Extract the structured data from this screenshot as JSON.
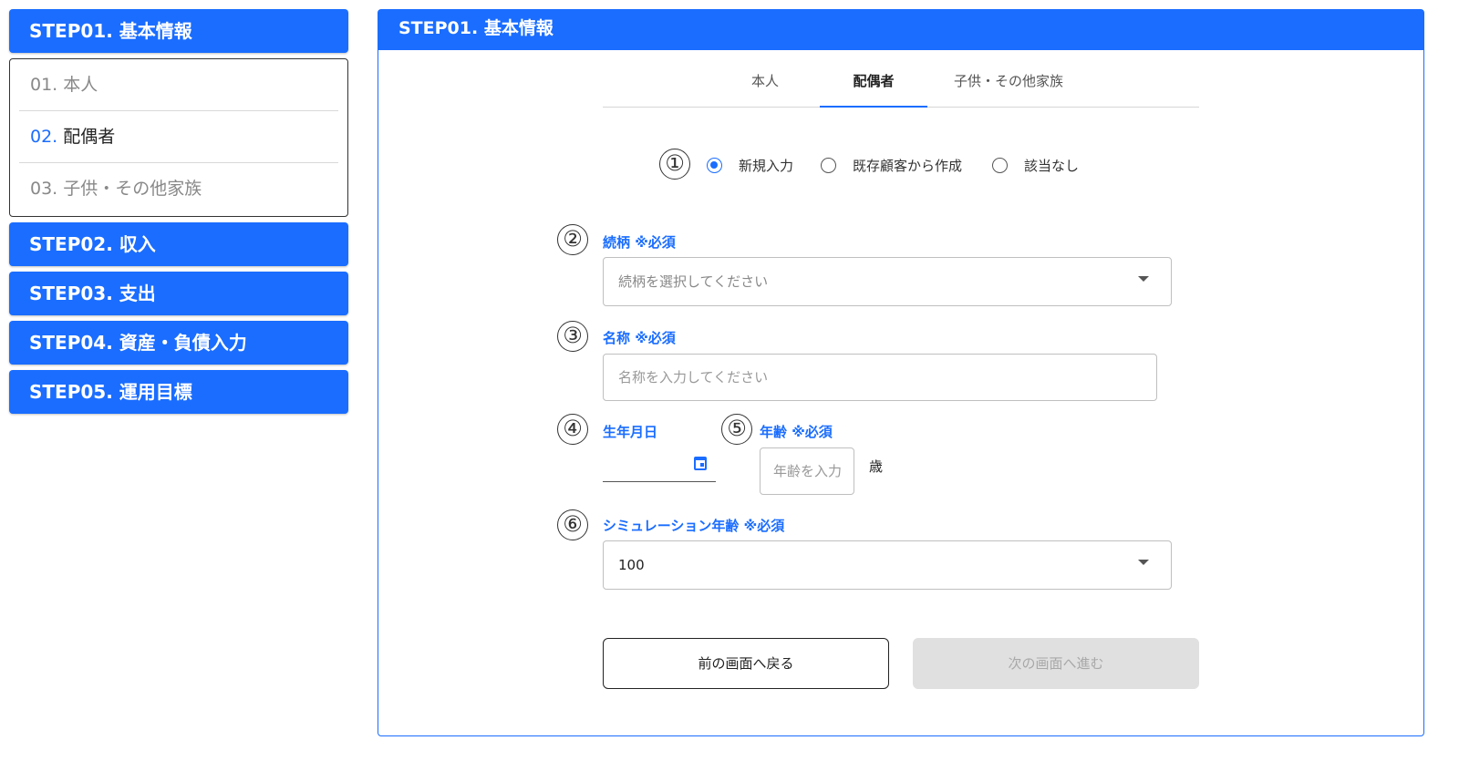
{
  "sidebar": {
    "step1": "STEP01. 基本情報",
    "substeps": [
      {
        "num": "01.",
        "label": "本人"
      },
      {
        "num": "02.",
        "label": "配偶者"
      },
      {
        "num": "03.",
        "label": "子供・その他家族"
      }
    ],
    "step2": "STEP02. 収入",
    "step3": "STEP03. 支出",
    "step4": "STEP04. 資産・負債入力",
    "step5": "STEP05. 運用目標"
  },
  "panel": {
    "title": "STEP01. 基本情報",
    "tabs": [
      "本人",
      "配偶者",
      "子供・その他家族"
    ],
    "active_tab": "配偶者"
  },
  "markers": [
    "①",
    "②",
    "③",
    "④",
    "⑤",
    "⑥"
  ],
  "source": {
    "options": [
      "新規入力",
      "既存顧客から作成",
      "該当なし"
    ],
    "selected": "新規入力"
  },
  "relationship": {
    "label": "続柄 ※必須",
    "placeholder": "続柄を選択してください"
  },
  "name": {
    "label": "名称 ※必須",
    "placeholder": "名称を入力してください"
  },
  "birthdate": {
    "label": "生年月日",
    "value": ""
  },
  "age": {
    "label": "年齢 ※必須",
    "placeholder": "年齢を入力",
    "unit": "歳"
  },
  "simulation_age": {
    "label": "シミュレーション年齢 ※必須",
    "value": "100"
  },
  "buttons": {
    "back": "前の画面へ戻る",
    "next": "次の画面へ進む"
  },
  "colors": {
    "accent": "#1a6dff",
    "disabled_bg": "#e0e0e0"
  }
}
